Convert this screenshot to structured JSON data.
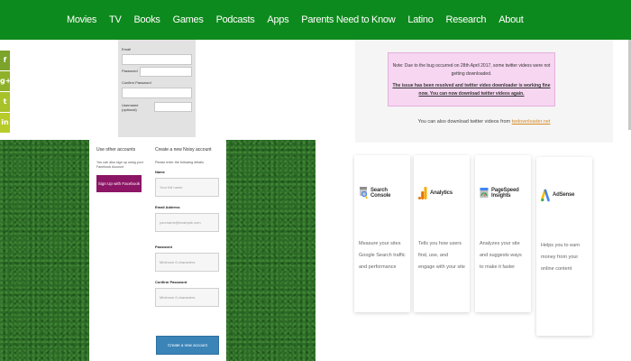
{
  "nav": {
    "items": [
      "Movies",
      "TV",
      "Books",
      "Games",
      "Podcasts",
      "Apps",
      "Parents Need to Know",
      "Latino",
      "Research",
      "About"
    ]
  },
  "social": {
    "fb": "f",
    "gp": "g+",
    "tw": "t",
    "in": "in"
  },
  "signup_top": {
    "email_label": "Email",
    "password_label": "Password",
    "confirm_label": "Confirm Password",
    "username_label": "Username (optional)"
  },
  "panel": {
    "left_heading": "Use other accounts",
    "left_text": "You can also sign up using your Facebook Account",
    "facebook_button": "Sign Up with Facebook",
    "right_heading": "Create a new Noisy account",
    "right_text": "Please enter the following details",
    "name_label": "Name",
    "name_placeholder": "Your full name",
    "email_label": "Email Address",
    "email_placeholder": "yourname@example.com",
    "password_label": "Password",
    "password_placeholder": "Minimum 6 characters",
    "confirm_label": "Confirm Password",
    "confirm_placeholder": "Minimum 6 characters",
    "create_button": "Create a new account"
  },
  "notice": {
    "line1": "Note: Due to the bug occurred on 28th April 2017, some twitter videos were not getting downloaded.",
    "line2": "The issue has been resolved and twitter video downloader is working fine now. You can now download twitter videos again.",
    "also_text": "You can also download twitter videos from ",
    "also_link": "twdownloader.net"
  },
  "cards": [
    {
      "title": "Search Console",
      "desc": "Measure your sites Google Search traffic and performance"
    },
    {
      "title": "Analytics",
      "desc": "Tells you how users find, use, and engage with your site"
    },
    {
      "title": "PageSpeed Insights",
      "desc": "Analyzes your site and suggests ways to make it faster"
    },
    {
      "title": "AdSense",
      "desc": "Helps you to earn money from your online content"
    }
  ],
  "colors": {
    "nav_bg": "#0d8a1d",
    "facebook_button": "#8c1565",
    "create_button": "#3a84b8",
    "notice_bg": "#f7d6f2",
    "link": "#d58a2a"
  }
}
